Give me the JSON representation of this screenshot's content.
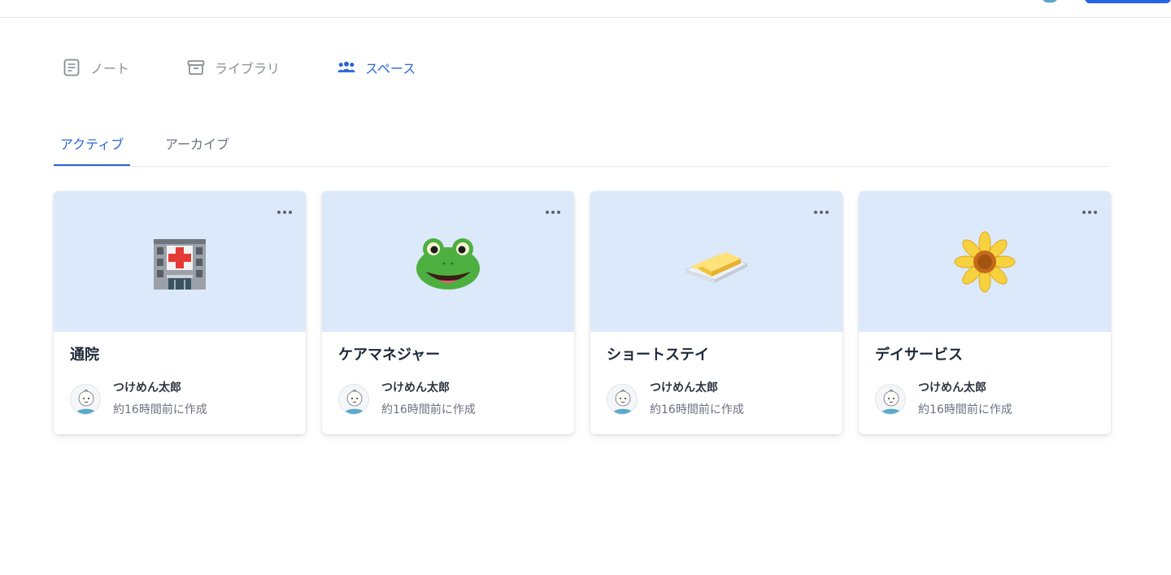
{
  "main_nav": {
    "notes_label": "ノート",
    "library_label": "ライブラリ",
    "spaces_label": "スペース"
  },
  "sub_tabs": {
    "active_label": "アクティブ",
    "archive_label": "アーカイブ"
  },
  "cards": [
    {
      "title": "通院",
      "icon": "hospital-icon",
      "author": "つけめん太郎",
      "created": "約16時間前に作成"
    },
    {
      "title": "ケアマネジャー",
      "icon": "frog-icon",
      "author": "つけめん太郎",
      "created": "約16時間前に作成"
    },
    {
      "title": "ショートステイ",
      "icon": "butter-icon",
      "author": "つけめん太郎",
      "created": "約16時間前に作成"
    },
    {
      "title": "デイサービス",
      "icon": "sunflower-icon",
      "author": "つけめん太郎",
      "created": "約16時間前に作成"
    }
  ],
  "colors": {
    "accent": "#2a66d6",
    "card_banner": "#dce9fb",
    "muted_text": "#6b7280"
  }
}
